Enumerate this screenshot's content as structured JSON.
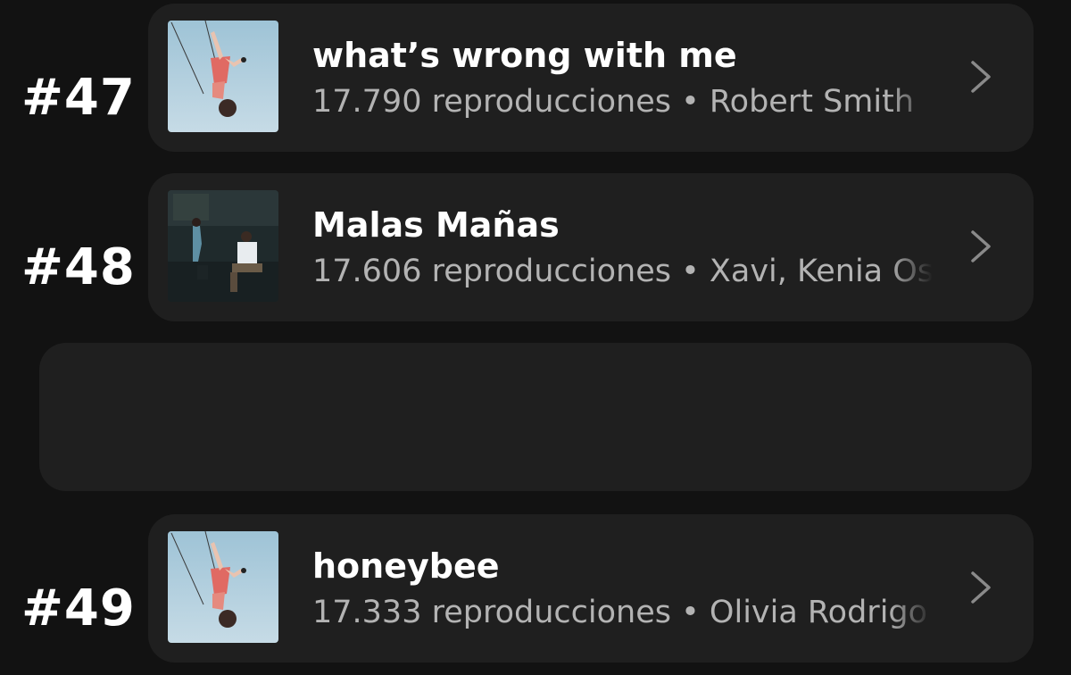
{
  "tracks": [
    {
      "rank": "#47",
      "title": "what’s wrong with me",
      "plays": "17.790 reproducciones",
      "separator": "•",
      "artist": "Robert Smith",
      "cover": "sky-swing-cover",
      "chevron": "chevron-right-icon"
    },
    {
      "rank": "#48",
      "title": "Malas Mañas",
      "plays": "17.606 reproducciones",
      "separator": "•",
      "artist": "Xavi, Kenia Os",
      "cover": "dark-room-cover",
      "chevron": "chevron-right-icon"
    },
    {
      "rank": "#49",
      "title": "honeybee",
      "plays": "17.333 reproducciones",
      "separator": "•",
      "artist": "Olivia Rodrigo",
      "cover": "sky-swing-cover",
      "chevron": "chevron-right-icon"
    }
  ],
  "colors": {
    "background": "#121212",
    "card": "#1f1f1f",
    "title": "#ffffff",
    "subtitle": "#b3b3b3",
    "chevron": "#8a8a8a"
  }
}
